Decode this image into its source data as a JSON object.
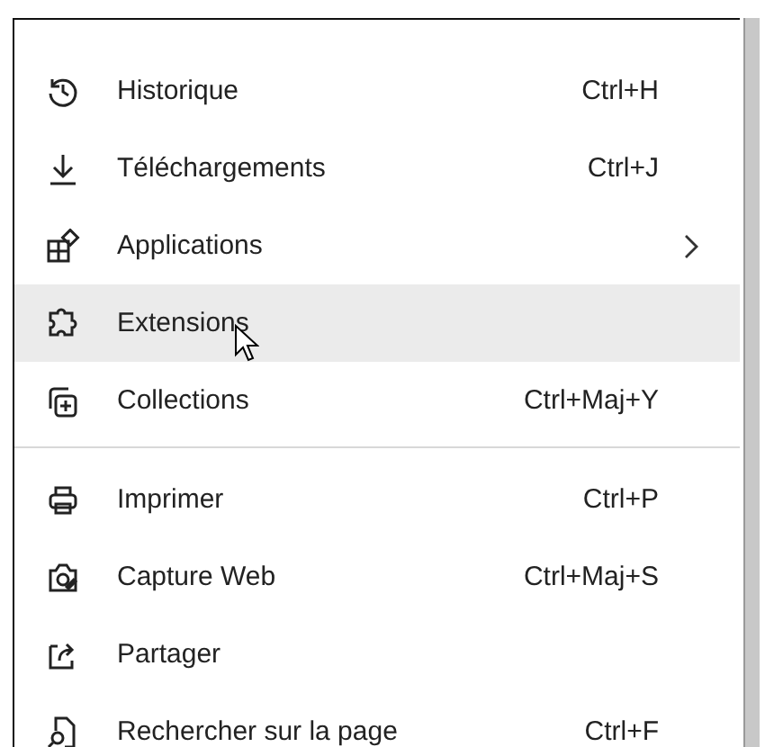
{
  "menu": {
    "items": [
      {
        "kind": "item",
        "label": "Historique",
        "shortcut": "Ctrl+H",
        "submenu": false,
        "highlighted": false
      },
      {
        "kind": "item",
        "label": "Téléchargements",
        "shortcut": "Ctrl+J",
        "submenu": false,
        "highlighted": false
      },
      {
        "kind": "item",
        "label": "Applications",
        "submenu": true,
        "highlighted": false
      },
      {
        "kind": "item",
        "label": "Extensions",
        "submenu": false,
        "highlighted": true
      },
      {
        "kind": "item",
        "label": "Collections",
        "shortcut": "Ctrl+Maj+Y",
        "submenu": false,
        "highlighted": false
      },
      {
        "kind": "separator"
      },
      {
        "kind": "item",
        "label": "Imprimer",
        "shortcut": "Ctrl+P",
        "submenu": false,
        "highlighted": false
      },
      {
        "kind": "item",
        "label": "Capture Web",
        "shortcut": "Ctrl+Maj+S",
        "submenu": false,
        "highlighted": false
      },
      {
        "kind": "item",
        "label": "Partager",
        "submenu": false,
        "highlighted": false
      },
      {
        "kind": "item",
        "label": "Rechercher sur la page",
        "shortcut": "Ctrl+F",
        "submenu": false,
        "highlighted": false
      }
    ]
  }
}
